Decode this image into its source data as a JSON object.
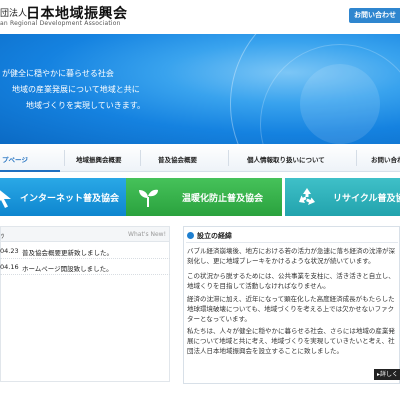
{
  "header": {
    "org_prefix": "団法人",
    "org_name": "日本地域振興会",
    "org_en": "an Regional Development Association",
    "contact_label": "お問い合わせ"
  },
  "hero": {
    "line1": "が健全に穏やかに暮らせる社会",
    "line2": "地域の産業発展について地域と共に",
    "line3": "地域づくりを実現していきます。"
  },
  "nav": {
    "items": [
      {
        "label": "プページ",
        "active": true
      },
      {
        "label": "地域振興会概要"
      },
      {
        "label": "普及協会概要"
      },
      {
        "label": "個人情報取り扱いについて"
      },
      {
        "label": "お問い合わせ"
      }
    ]
  },
  "banners": {
    "internet": "インターネット普及協会",
    "warming": "温暖化防止普及協会",
    "recycle": "リサイクル普及協会"
  },
  "news": {
    "header_left": "ﾂ",
    "more_label": "What's New!",
    "items": [
      {
        "date": "04.23",
        "text": "普及協会概要更新致しました。"
      },
      {
        "date": "04.16",
        "text": "ホームページ開設致しました。"
      }
    ]
  },
  "about": {
    "title": "設立の経緯",
    "p1": "バブル経済崩壊後、地方における若の活力が急速に落ち経済の沈滞が深刻化し、更に地域ブレーキをかけるような状況が続いています。",
    "p2": "この状況から脱するためには、公共事業を支柱に、活き活きと自立し、地域くりを目指して活動しなければなりません。",
    "p3": "経済の沈滞に加え、近年になって顕在化した高度経済成長がもたらした地球環境破壊についても、地域づくりを考える上では欠かせないファクターとなっています。",
    "p4": "私たちは、人々が健全に穏やかに暮らせる社会、さらには地域の産業発展について地域と共に考え、地域づくりを実現していきたいと考え、社団法人日本地域振興会を設立することに致しました。",
    "detail_label": "詳しく"
  },
  "colors": {
    "accent": "#2f86cf",
    "internet": "#1497d9",
    "warming": "#3ab24d",
    "recycle": "#2fb2bb"
  }
}
